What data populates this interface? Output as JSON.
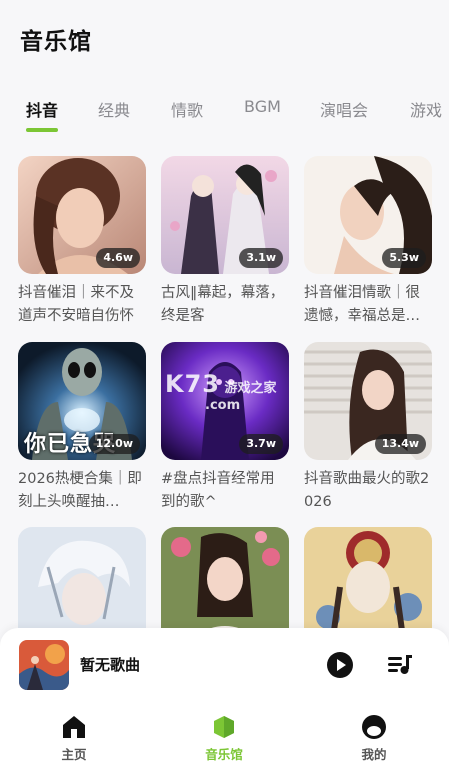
{
  "page": {
    "title": "音乐馆"
  },
  "tabs": [
    {
      "label": "抖音",
      "active": true
    },
    {
      "label": "经典"
    },
    {
      "label": "情歌"
    },
    {
      "label": "BGM"
    },
    {
      "label": "演唱会"
    },
    {
      "label": "游戏"
    }
  ],
  "cards": [
    {
      "title": "抖音催泪｜来不及道声不安暗自伤怀",
      "plays": "4.6w"
    },
    {
      "title": "古风‖幕起，幕落，终是客",
      "plays": "3.1w"
    },
    {
      "title": "抖音催泪情歌｜很遗憾，幸福总是…",
      "plays": "5.3w"
    },
    {
      "title": "2026热梗合集｜即刻上头唤醒抽…",
      "plays": "12.0w",
      "overlay": "你已急哭"
    },
    {
      "title": "#盘点抖音经常用到的歌^",
      "plays": "3.7w",
      "watermark_top": "K73",
      "watermark_main": "游戏之家",
      "watermark_sub": ".com"
    },
    {
      "title": "抖音歌曲最火的歌2026",
      "plays": "13.4w"
    },
    {
      "title": "",
      "plays": ""
    },
    {
      "title": "",
      "plays": ""
    },
    {
      "title": "",
      "plays": ""
    }
  ],
  "player": {
    "title": "暂无歌曲"
  },
  "nav": [
    {
      "label": "主页",
      "icon": "home-icon"
    },
    {
      "label": "音乐馆",
      "icon": "music-hall-icon",
      "active": true
    },
    {
      "label": "我的",
      "icon": "profile-icon"
    }
  ],
  "colors": {
    "accent": "#7cc635",
    "background": "#f7f7f9"
  }
}
